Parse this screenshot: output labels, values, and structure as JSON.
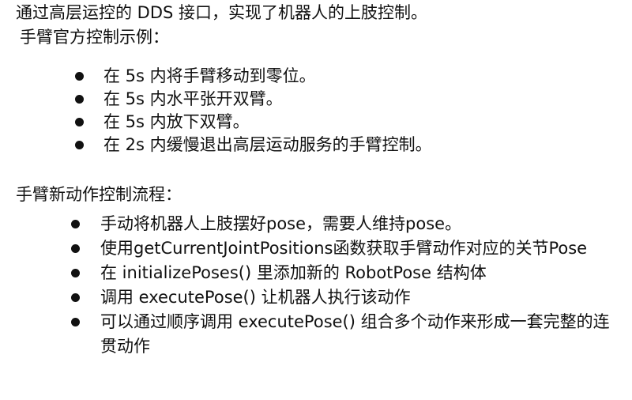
{
  "intro": "通过高层运控的 DDS 接口，实现了机器人的上肢控制。",
  "example_heading": "手臂官方控制示例：",
  "example_items": [
    "在 5s 内将手臂移动到零位。",
    "在 5s 内水平张开双臂。",
    "在 5s 内放下双臂。",
    "在 2s 内缓慢退出高层运动服务的手臂控制。"
  ],
  "flow_heading": "手臂新动作控制流程：",
  "flow_items": [
    "手动将机器人上肢摆好pose，需要人维持pose。",
    "使用getCurrentJointPositions函数获取手臂动作对应的关节Pose",
    "在 initializePoses() 里添加新的 RobotPose 结构体",
    "调用 executePose() 让机器人执行该动作",
    "可以通过顺序调用 executePose() 组合多个动作来形成一套完整的连贯动作"
  ]
}
